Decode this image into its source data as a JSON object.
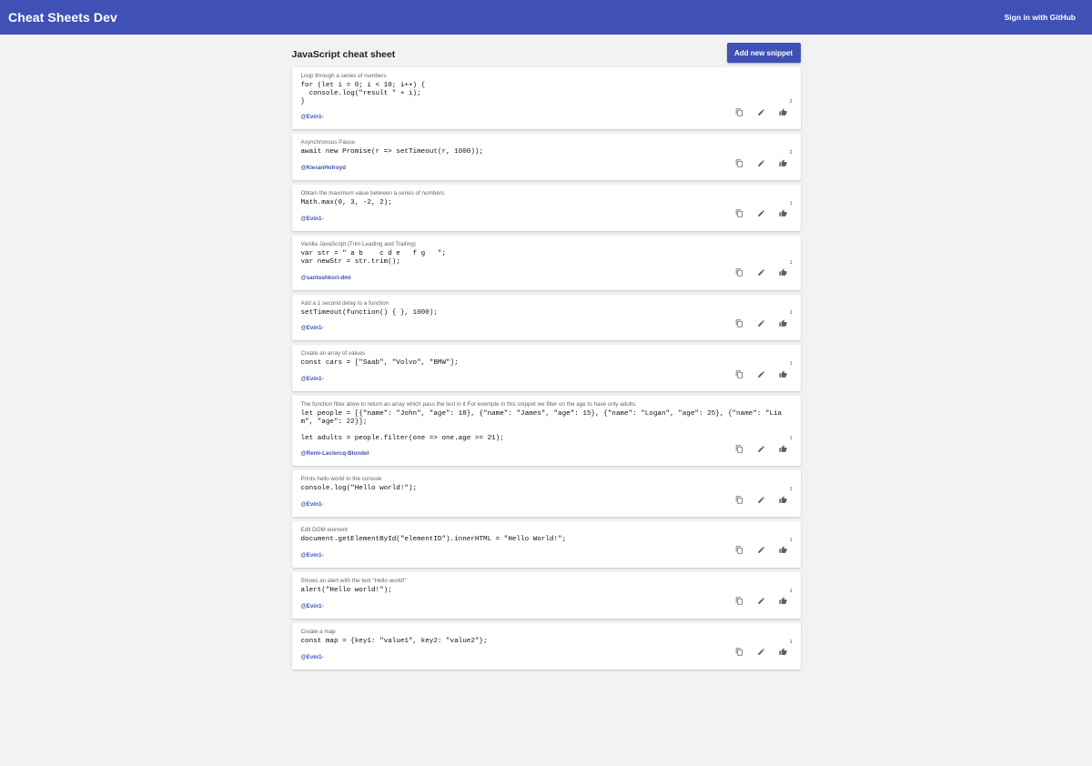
{
  "app": {
    "title": "Cheat Sheets Dev",
    "signin_label": "Sign in with GitHub"
  },
  "page": {
    "title": "JavaScript cheat sheet",
    "add_label": "Add new snippet"
  },
  "snippets": [
    {
      "description": "Loop through a series of numbers",
      "code": "for (let i = 0; i < 10; i++) {\n  console.log(\"result \" + i);\n}",
      "author": "@Evin1-",
      "likes": "2"
    },
    {
      "description": "Asynchronous Pause",
      "code": "await new Promise(r => setTimeout(r, 1000));",
      "author": "@KieranHolroyd",
      "likes": "2"
    },
    {
      "description": "Obtain the maximum value between a series of numbers",
      "code": "Math.max(0, 3, -2, 2);",
      "author": "@Evin1-",
      "likes": "1"
    },
    {
      "description": "Vanilla JavaScript (Trim Leading and Trailing)",
      "code": "var str = \" a b    c d e   f g   \";\nvar newStr = str.trim();",
      "author": "@santoshkori-dmi",
      "likes": "1"
    },
    {
      "description": "Add a 1 second delay to a function",
      "code": "setTimeout(function() { }, 1000);",
      "author": "@Evin1-",
      "likes": "1"
    },
    {
      "description": "Create an array of values",
      "code": "const cars = [\"Saab\", \"Volvo\", \"BMW\"];",
      "author": "@Evin1-",
      "likes": "1"
    },
    {
      "description": "The function filter allow to return an array which pass the test in it For exemple in this snippet we filter on the age to have only adults.",
      "code": "let people = [{\"name\": \"John\", \"age\": 18}, {\"name\": \"James\", \"age\": 15}, {\"name\": \"Logan\", \"age\": 25}, {\"name\": \"Liam\", \"age\": 22}];\n\nlet adults = people.filter(one => one.age >= 21);",
      "author": "@Remi-Leclercq-Blondel",
      "likes": "1"
    },
    {
      "description": "Prints hello world to the console",
      "code": "console.log(\"Hello world!\");",
      "author": "@Evin1-",
      "likes": "1"
    },
    {
      "description": "Edit DOM element",
      "code": "document.getElementById(\"elementID\").innerHTML = \"Hello World!\";",
      "author": "@Evin1-",
      "likes": "1"
    },
    {
      "description": "Shows an alert with the text \"Hello world!\"",
      "code": "alert(\"Hello world!\");",
      "author": "@Evin1-",
      "likes": "1"
    },
    {
      "description": "Create a map",
      "code": "const map = {key1: \"value1\", key2: \"value2\"};",
      "author": "@Evin1-",
      "likes": "1"
    }
  ],
  "icons": {
    "copy": "copy-icon",
    "edit": "edit-icon",
    "like": "thumb-up-icon"
  },
  "colors": {
    "primary": "#3f51b5",
    "background": "#f2f2f2"
  }
}
